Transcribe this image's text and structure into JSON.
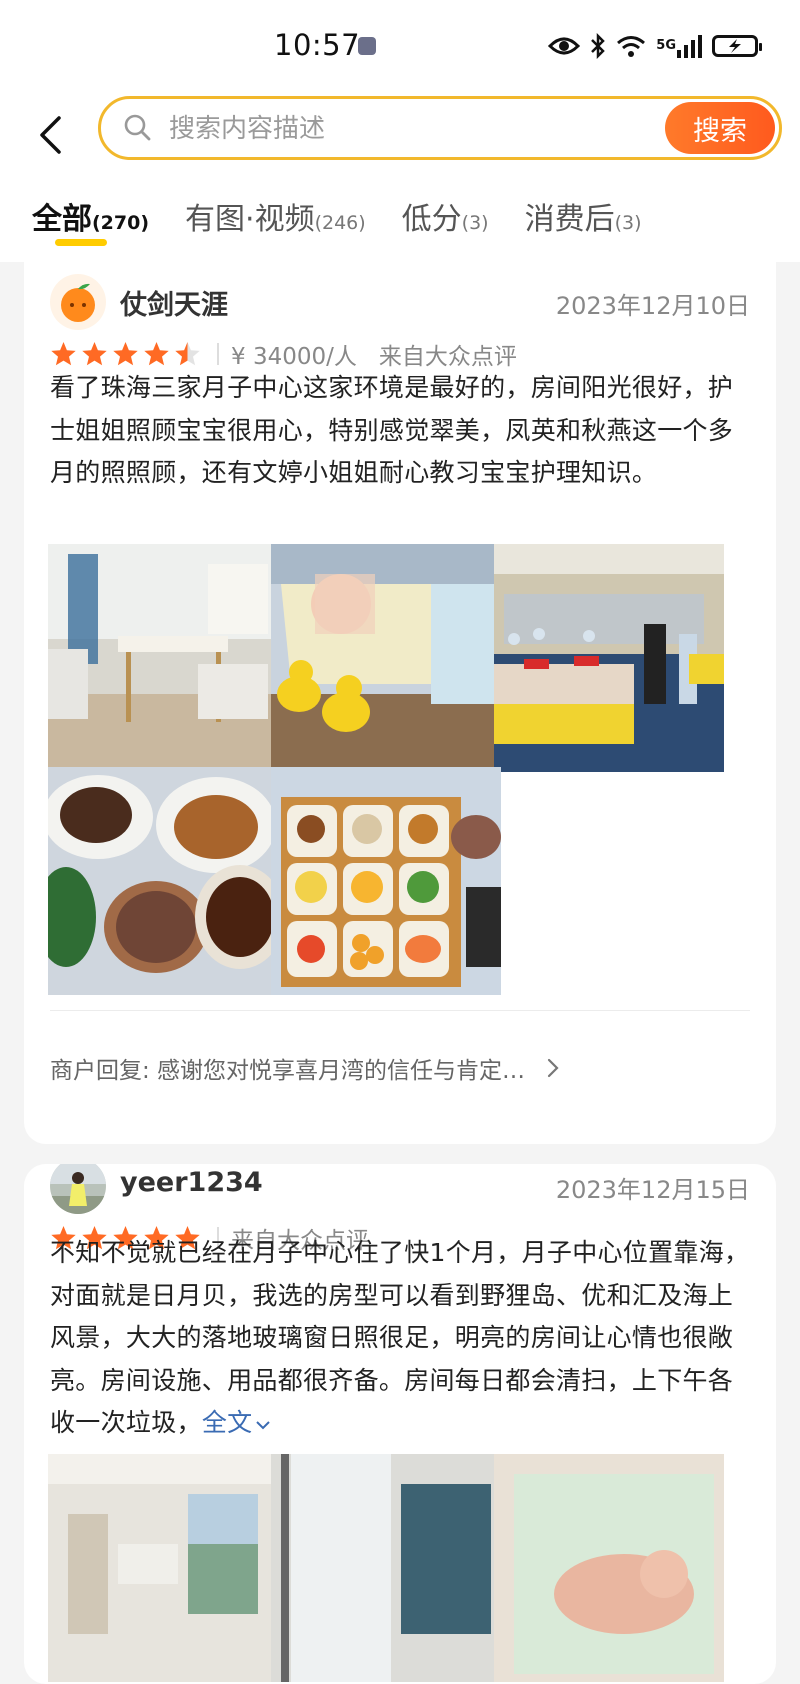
{
  "status_bar": {
    "time": "10:57",
    "network_label": "5G",
    "icons": [
      "eye-icon",
      "bluetooth-icon",
      "wifi-icon",
      "signal-icon",
      "battery-icon"
    ]
  },
  "search": {
    "placeholder": "搜索内容描述",
    "button_label": "搜索"
  },
  "tabs": [
    {
      "label": "全部",
      "count": "(270)",
      "active": true
    },
    {
      "label": "有图·视频",
      "count": "(246)",
      "active": false
    },
    {
      "label": "低分",
      "count": "(3)",
      "active": false
    },
    {
      "label": "消费后",
      "count": "(3)",
      "active": false
    }
  ],
  "reviews": [
    {
      "user": "仗剑天涯",
      "date": "2023年12月10日",
      "rating": 4.5,
      "price": "¥ 34000/人",
      "source": "来自大众点评",
      "text": "看了珠海三家月子中心这家环境是最好的，房间阳光很好，护士姐姐照顾宝宝很用心，特别感觉翠美，凤英和秋燕这一个多月的照照顾，还有文婷小姐姐耐心教习宝宝护理知识。",
      "photos": [
        "dining-room-photo",
        "baby-with-ducks-photo",
        "banquet-hall-photo",
        "meal-dishes-photo",
        "meal-tray-photo"
      ],
      "merchant_reply": "商户回复: 感谢您对悦享喜月湾的信任与肯定…"
    },
    {
      "user": "yeer1234",
      "date": "2023年12月15日",
      "rating": 5,
      "source": "来自大众点评",
      "text": "不知不觉就已经在月子中心住了快1个月，月子中心位置靠海，对面就是日月贝，我选的房型可以看到野狸岛、优和汇及海上风景，大大的落地玻璃窗日照很足，明亮的房间让心情也很敞亮。房间设施、用品都很齐备。房间每日都会清扫，上下午各收一次垃圾，",
      "more_label": "全文",
      "photos": [
        "room-photo",
        "window-view-photo",
        "newborn-photo"
      ]
    }
  ],
  "colors": {
    "accent_orange": "#ff6a24",
    "search_border": "#f2b82c",
    "tab_indicator": "#ffcc00",
    "star": "#ff6a24",
    "link": "#3a6bb3"
  }
}
